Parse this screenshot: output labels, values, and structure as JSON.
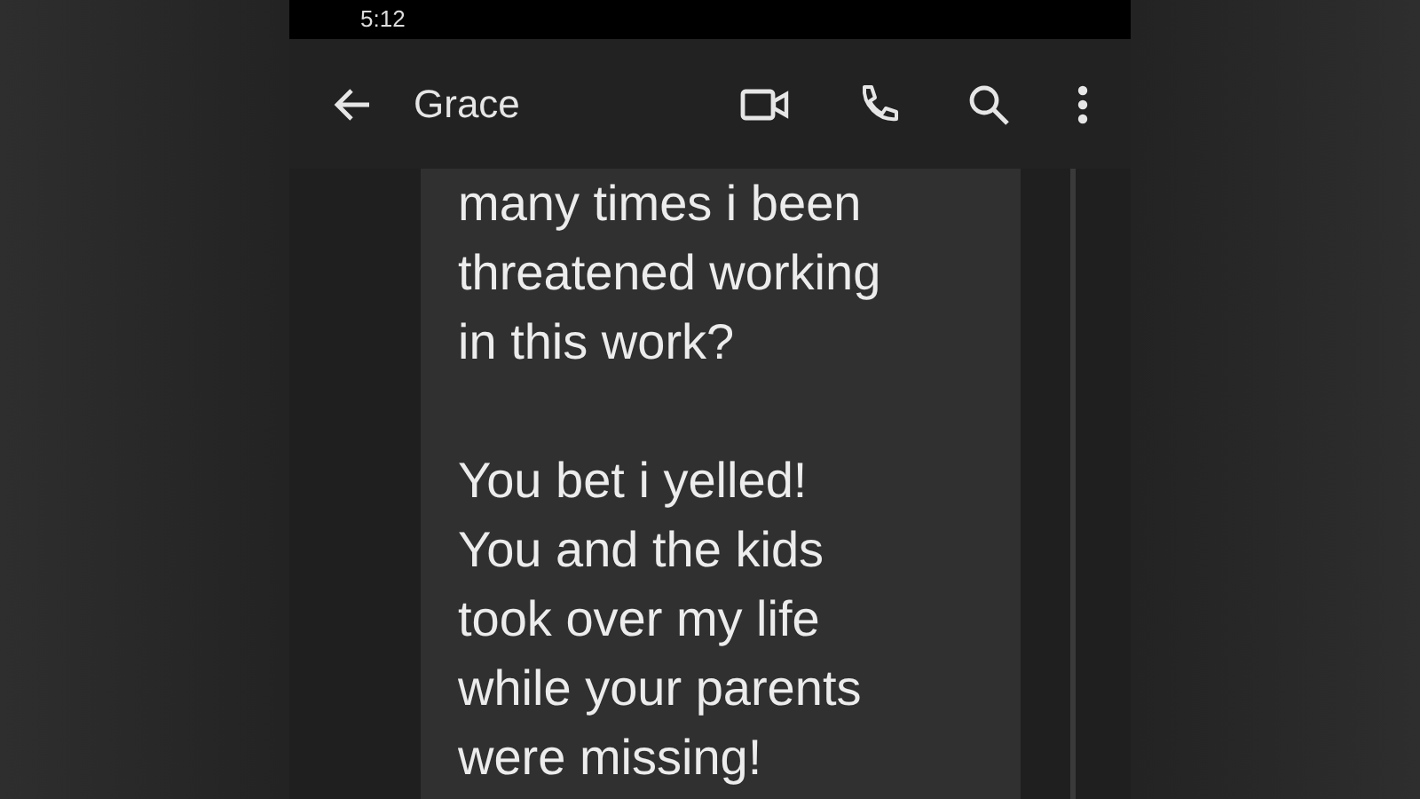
{
  "status_bar": {
    "time": "5:12"
  },
  "app_bar": {
    "title": "Grace"
  },
  "message": {
    "paragraphs": [
      {
        "lines": [
          "many times i been",
          "threatened working",
          "in this work?"
        ]
      },
      {
        "lines": [
          "You bet i yelled!",
          "You and the kids",
          "took over my life",
          "while your parents",
          "were missing!"
        ]
      }
    ]
  }
}
